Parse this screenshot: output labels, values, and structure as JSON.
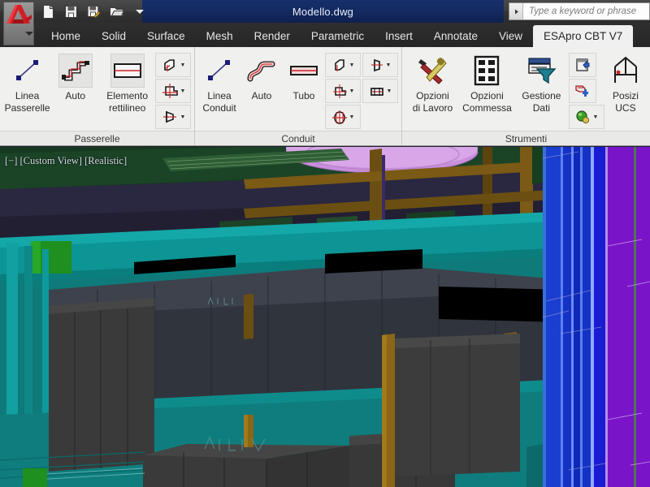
{
  "window": {
    "title": "Modello.dwg",
    "logo_icon": "autocad-a-logo"
  },
  "quick_access": [
    {
      "name": "new-document",
      "icon": "new-file-icon"
    },
    {
      "name": "save",
      "icon": "floppy-disk-icon"
    },
    {
      "name": "save-as",
      "icon": "floppy-disk-pencil-icon"
    },
    {
      "name": "open",
      "icon": "open-folder-icon"
    },
    {
      "name": "customize-quick-access",
      "icon": "chevron-down-icon"
    }
  ],
  "search": {
    "placeholder": "Type a keyword or phrase",
    "expand_icon": "chevron-right-icon"
  },
  "tabs": [
    {
      "label": "Home",
      "active": false
    },
    {
      "label": "Solid",
      "active": false
    },
    {
      "label": "Surface",
      "active": false
    },
    {
      "label": "Mesh",
      "active": false
    },
    {
      "label": "Render",
      "active": false
    },
    {
      "label": "Parametric",
      "active": false
    },
    {
      "label": "Insert",
      "active": false
    },
    {
      "label": "Annotate",
      "active": false
    },
    {
      "label": "View",
      "active": false
    },
    {
      "label": "ESApro CBT V7",
      "active": true
    }
  ],
  "ribbon": {
    "panels": [
      {
        "title": "Passerelle",
        "buttons": [
          {
            "label": "Linea\nPasserelle",
            "label_line1": "Linea",
            "label_line2": "Passerelle",
            "icon": "line-segment-icon"
          },
          {
            "label": "Auto",
            "label_line1": "Auto",
            "label_line2": "",
            "icon": "auto-cabletray-route-icon"
          },
          {
            "label": "Elemento rettilineo",
            "label_line1": "Elemento",
            "label_line2": "rettilineo",
            "icon": "straight-element-icon"
          }
        ],
        "small_buttons": [
          {
            "name": "tray-elbow",
            "icon": "tray-elbow-icon",
            "has_dropdown": true
          },
          {
            "name": "tray-tee",
            "icon": "tray-tee-icon",
            "has_dropdown": true
          },
          {
            "name": "tray-reducer",
            "icon": "tray-reducer-icon",
            "has_dropdown": true
          }
        ]
      },
      {
        "title": "Conduit",
        "buttons": [
          {
            "label": "Linea Conduit",
            "label_line1": "Linea",
            "label_line2": "Conduit",
            "icon": "line-segment-icon"
          },
          {
            "label": "Auto",
            "label_line1": "Auto",
            "label_line2": "",
            "icon": "auto-conduit-route-icon"
          },
          {
            "label": "Tubo",
            "label_line1": "Tubo",
            "label_line2": "",
            "icon": "pipe-icon"
          }
        ],
        "small_buttons": [
          {
            "name": "conduit-elbow",
            "icon": "conduit-elbow-icon",
            "has_dropdown": true
          },
          {
            "name": "conduit-cap",
            "icon": "conduit-cap-icon",
            "has_dropdown": true
          },
          {
            "name": "conduit-tee",
            "icon": "conduit-tee-icon",
            "has_dropdown": true
          },
          {
            "name": "conduit-coupling",
            "icon": "conduit-coupling-icon",
            "has_dropdown": true
          },
          {
            "name": "conduit-cross",
            "icon": "conduit-cross-icon",
            "has_dropdown": true
          }
        ]
      },
      {
        "title": "Strumenti",
        "buttons": [
          {
            "label": "Opzioni di Lavoro",
            "label_line1": "Opzioni",
            "label_line2": "di Lavoro",
            "icon": "hammer-wrench-icon"
          },
          {
            "label": "Opzioni Commessa",
            "label_line1": "Opzioni",
            "label_line2": "Commessa",
            "icon": "grid-table-icon"
          },
          {
            "label": "Gestione Dati",
            "label_line1": "Gestione",
            "label_line2": "Dati",
            "icon": "data-filter-icon"
          },
          {
            "label": "Posiziona UCS",
            "label_line1": "Posizi",
            "label_line2": "UCS",
            "icon": "ucs-position-icon"
          }
        ],
        "small_buttons": [
          {
            "name": "export-data",
            "icon": "export-page-icon",
            "has_dropdown": false
          },
          {
            "name": "insert-block",
            "icon": "insert-block-icon",
            "has_dropdown": false
          },
          {
            "name": "render-object",
            "icon": "green-sphere-icon",
            "has_dropdown": true
          }
        ]
      }
    ]
  },
  "viewport": {
    "label": "[−] [Custom View] [Realistic]",
    "view_name": "Custom View",
    "visual_style": "Realistic",
    "colors": {
      "floor_teal": "#0f7a7a",
      "ceiling_dark": "#2b2b44",
      "green_slab": "#1f4a2a",
      "purple_duct": "#c58fd6",
      "blue_wall": "#1414c8",
      "violet_wall": "#7a14c8",
      "box_gray": "#3c3c3c",
      "beam_brown": "#7a5a14"
    }
  }
}
